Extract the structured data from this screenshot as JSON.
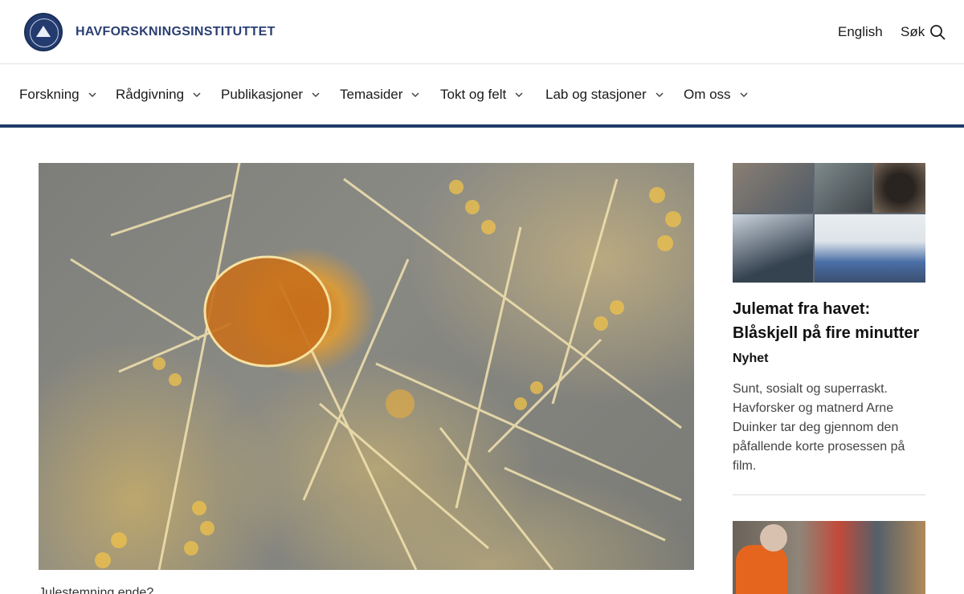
{
  "header": {
    "brand": "HAVFORSKNINGSINSTITUTTET",
    "language_link": "English",
    "search_label": "Søk"
  },
  "nav": {
    "items": [
      {
        "label": "Forskning"
      },
      {
        "label": "Rådgivning"
      },
      {
        "label": "Publikasjoner"
      },
      {
        "label": "Temasider"
      },
      {
        "label": "Tokt og felt"
      },
      {
        "label": "Lab og stasjoner"
      },
      {
        "label": "Om oss"
      }
    ]
  },
  "main": {
    "caption": "Julestemning ende?"
  },
  "sidebar": {
    "article": {
      "title": "Julemat fra havet: Blåskjell på fire minutter",
      "tag": "Nyhet",
      "summary": "Sunt, sosialt og superraskt. Havforsker og matnerd Arne Duinker tar deg gjennom den påfallende korte prosessen på film."
    }
  },
  "colors": {
    "brand": "#2b3f73",
    "nav_rule": "#1f3a68"
  },
  "icons": {
    "logo": "institute-seal-icon",
    "search": "search-icon",
    "dropdown": "chevron-down-icon"
  }
}
